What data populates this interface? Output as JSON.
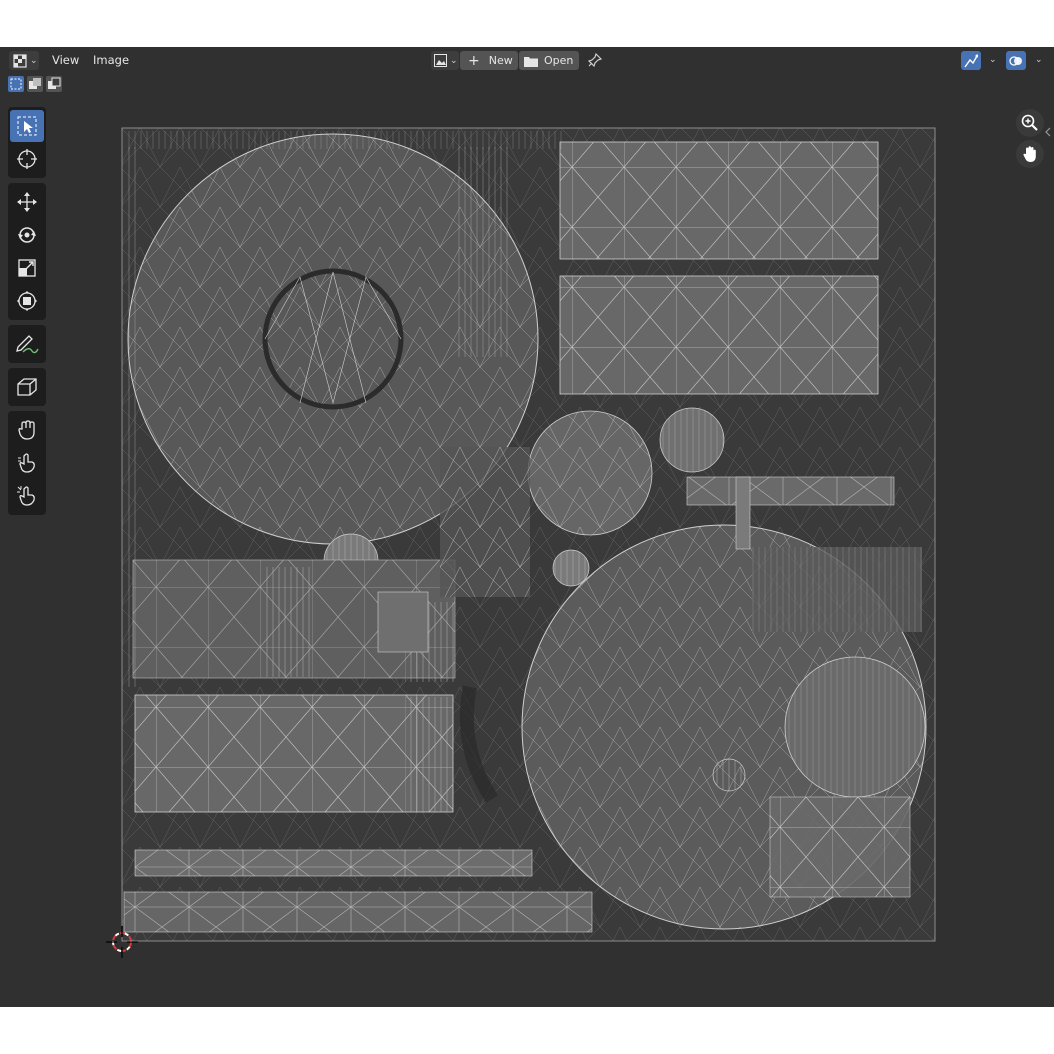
{
  "window": {
    "editor_type_icon": "uv-editor-icon"
  },
  "menu": {
    "items": [
      {
        "label": "View"
      },
      {
        "label": "Image"
      }
    ]
  },
  "image_controls": {
    "browse_icon": "image-browse-icon",
    "new_label": "New",
    "open_label": "Open",
    "pin_icon": "pin-icon"
  },
  "header_right": {
    "snap_icon": "uv-sync-selection-icon",
    "overlay_icon": "overlay-icon"
  },
  "select_modes": [
    {
      "name": "select-new",
      "active": true
    },
    {
      "name": "select-extend",
      "active": false
    },
    {
      "name": "select-subtract",
      "active": false
    }
  ],
  "tools": [
    {
      "group": 1,
      "name": "select-box",
      "icon": "select-box-icon",
      "active": true
    },
    {
      "group": 1,
      "name": "cursor",
      "icon": "cursor-icon",
      "active": false
    },
    {
      "group": 2,
      "name": "move",
      "icon": "move-icon",
      "active": false
    },
    {
      "group": 2,
      "name": "rotate",
      "icon": "rotate-icon",
      "active": false
    },
    {
      "group": 2,
      "name": "scale",
      "icon": "scale-icon",
      "active": false
    },
    {
      "group": 2,
      "name": "transform",
      "icon": "transform-icon",
      "active": false
    },
    {
      "group": 3,
      "name": "annotate",
      "icon": "annotate-icon",
      "active": false
    },
    {
      "group": 4,
      "name": "rip-region",
      "icon": "rip-region-icon",
      "active": false
    },
    {
      "group": 5,
      "name": "grab",
      "icon": "grab-icon",
      "active": false
    },
    {
      "group": 5,
      "name": "relax",
      "icon": "relax-icon",
      "active": false
    },
    {
      "group": 5,
      "name": "pinch",
      "icon": "pinch-icon",
      "active": false
    }
  ],
  "navigation": [
    {
      "name": "zoom",
      "icon": "zoom-icon"
    },
    {
      "name": "pan",
      "icon": "hand-icon"
    }
  ],
  "colors": {
    "background": "#303030",
    "uv_fill": "#6e6e6e",
    "uv_edge": "#cfcfcf",
    "accent": "#4772b3",
    "cursor_red": "#d23c3c"
  }
}
